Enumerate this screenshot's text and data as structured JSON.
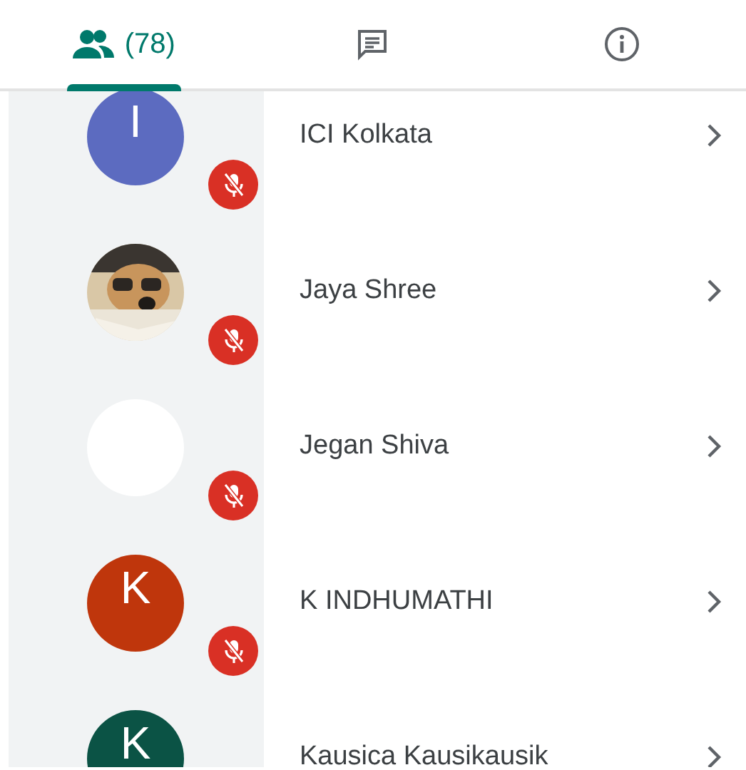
{
  "tabs": [
    {
      "kind": "people",
      "label": "(78)",
      "selected": true
    },
    {
      "kind": "chat",
      "selected": false
    },
    {
      "kind": "info",
      "selected": false
    }
  ],
  "participants": [
    {
      "name": "ICI Kolkata",
      "avatar": {
        "kind": "letter",
        "letter": "I",
        "color": "#5c6bc0"
      },
      "muted": true
    },
    {
      "name": "Jaya Shree",
      "muted": true
    },
    {
      "name": "Jegan Shiva",
      "avatar": {
        "kind": "blank"
      },
      "muted": true
    },
    {
      "name": "K INDHUMATHI",
      "avatar": {
        "kind": "letter",
        "letter": "K",
        "color": "#bf360c"
      },
      "muted": true
    },
    {
      "name": "Kausica Kausikausik",
      "avatar": {
        "kind": "letter",
        "letter": "K",
        "color": "#0b5345"
      },
      "muted": false
    }
  ]
}
